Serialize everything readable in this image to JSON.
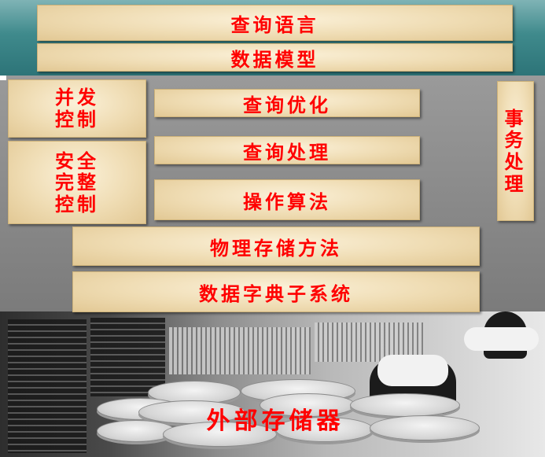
{
  "layers": {
    "query_language": "查询语言",
    "data_model": "数据模型",
    "query_optimization": "查询优化",
    "query_processing": "查询处理",
    "operation_algorithm": "操作算法",
    "physical_storage": "物理存储方法",
    "data_dictionary": "数据字典子系统",
    "external_storage": "外部存储器"
  },
  "left_blocks": {
    "concurrency": [
      "并发",
      "控制"
    ],
    "security": [
      "安全",
      "完整",
      "控制"
    ]
  },
  "right_block": {
    "transaction": [
      "事",
      "务",
      "处",
      "理"
    ]
  },
  "colors": {
    "text_red": "#ff0000",
    "top_band": "#3f8a8c",
    "middle_band": "#8a8a8a",
    "box_fill": "#efdcb3"
  }
}
